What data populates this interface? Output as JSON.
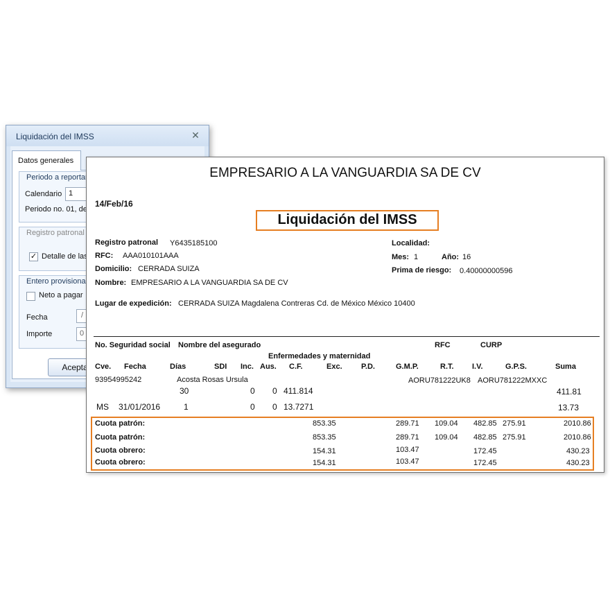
{
  "dialog": {
    "title": "Liquidación del IMSS",
    "close_icon": "close-icon",
    "tab": "Datos generales",
    "periodo_group": "Periodo a reportar",
    "calendario_label": "Calendario",
    "calendario_value": "1",
    "periodo_text": "Periodo no. 01, de",
    "registro_group": "Registro patronal",
    "detalle_label": "Detalle de las",
    "entero_group": "Entero provisional",
    "neto_label": "Neto a pagar",
    "fecha_label": "Fecha",
    "fecha_value": "/",
    "importe_label": "Importe",
    "importe_value": "0",
    "aceptar": "Aceptar"
  },
  "report": {
    "company": "EMPRESARIO A LA VANGUARDIA SA DE CV",
    "date": "14/Feb/16",
    "title": "Liquidación del IMSS",
    "registro_label": "Registro patronal",
    "registro_value": "Y6435185100",
    "rfc_label": "RFC:",
    "rfc_value": "AAA010101AAA",
    "domicilio_label": "Domicilio:",
    "domicilio_value": "CERRADA SUIZA",
    "nombre_label": "Nombre:",
    "nombre_value": "EMPRESARIO A LA VANGUARDIA SA DE CV",
    "localidad_label": "Localidad:",
    "mes_label": "Mes:",
    "mes_value": "1",
    "anio_label": "Año:",
    "anio_value": "16",
    "prima_label": "Prima de riesgo:",
    "prima_value": "0.40000000596",
    "lugar_label": "Lugar de expedición:",
    "lugar_value": "CERRADA SUIZA Magdalena Contreras Cd. de México México 10400",
    "headers": {
      "nss": "No. Seguridad social",
      "nombre": "Nombre del asegurado",
      "rfc": "RFC",
      "curp": "CURP",
      "enf": "Enfermedades y maternidad",
      "cve": "Cve.",
      "fecha": "Fecha",
      "dias": "Días",
      "sdi": "SDI",
      "inc": "Inc.",
      "aus": "Aus.",
      "cf": "C.F.",
      "exc": "Exc.",
      "pd": "P.D.",
      "gmp": "G.M.P.",
      "rt": "R.T.",
      "iv": "I.V.",
      "gps": "G.P.S.",
      "suma": "Suma"
    },
    "employee": {
      "nss": "93954995242",
      "nombre": "Acosta Rosas Ursula",
      "rfc": "AORU781222UK8",
      "curp": "AORU781222MXXC",
      "row1": {
        "dias": "30",
        "inc": "0",
        "aus": "0",
        "cf": "411.814",
        "suma": "411.81"
      },
      "row2": {
        "cve": "MS",
        "fecha": "31/01/2016",
        "dias": "1",
        "inc": "0",
        "aus": "0",
        "cf": "13.7271",
        "suma": "13.73"
      }
    },
    "totals": [
      {
        "label": "Cuota patrón:",
        "exc": "853.35",
        "gmp": "289.71",
        "rt": "109.04",
        "iv": "482.85",
        "gps": "275.91",
        "suma": "2010.86"
      },
      {
        "label": "Cuota patrón:",
        "exc": "853.35",
        "gmp": "289.71",
        "rt": "109.04",
        "iv": "482.85",
        "gps": "275.91",
        "suma": "2010.86"
      },
      {
        "label": "Cuota obrero:",
        "exc": "154.31",
        "gmp": "103.47",
        "rt": "",
        "iv": "172.45",
        "gps": "",
        "suma": "430.23"
      },
      {
        "label": "Cuota obrero:",
        "exc": "154.31",
        "gmp": "103.47",
        "rt": "",
        "iv": "172.45",
        "gps": "",
        "suma": "430.23"
      }
    ],
    "highlight_color": "#e67e22"
  }
}
